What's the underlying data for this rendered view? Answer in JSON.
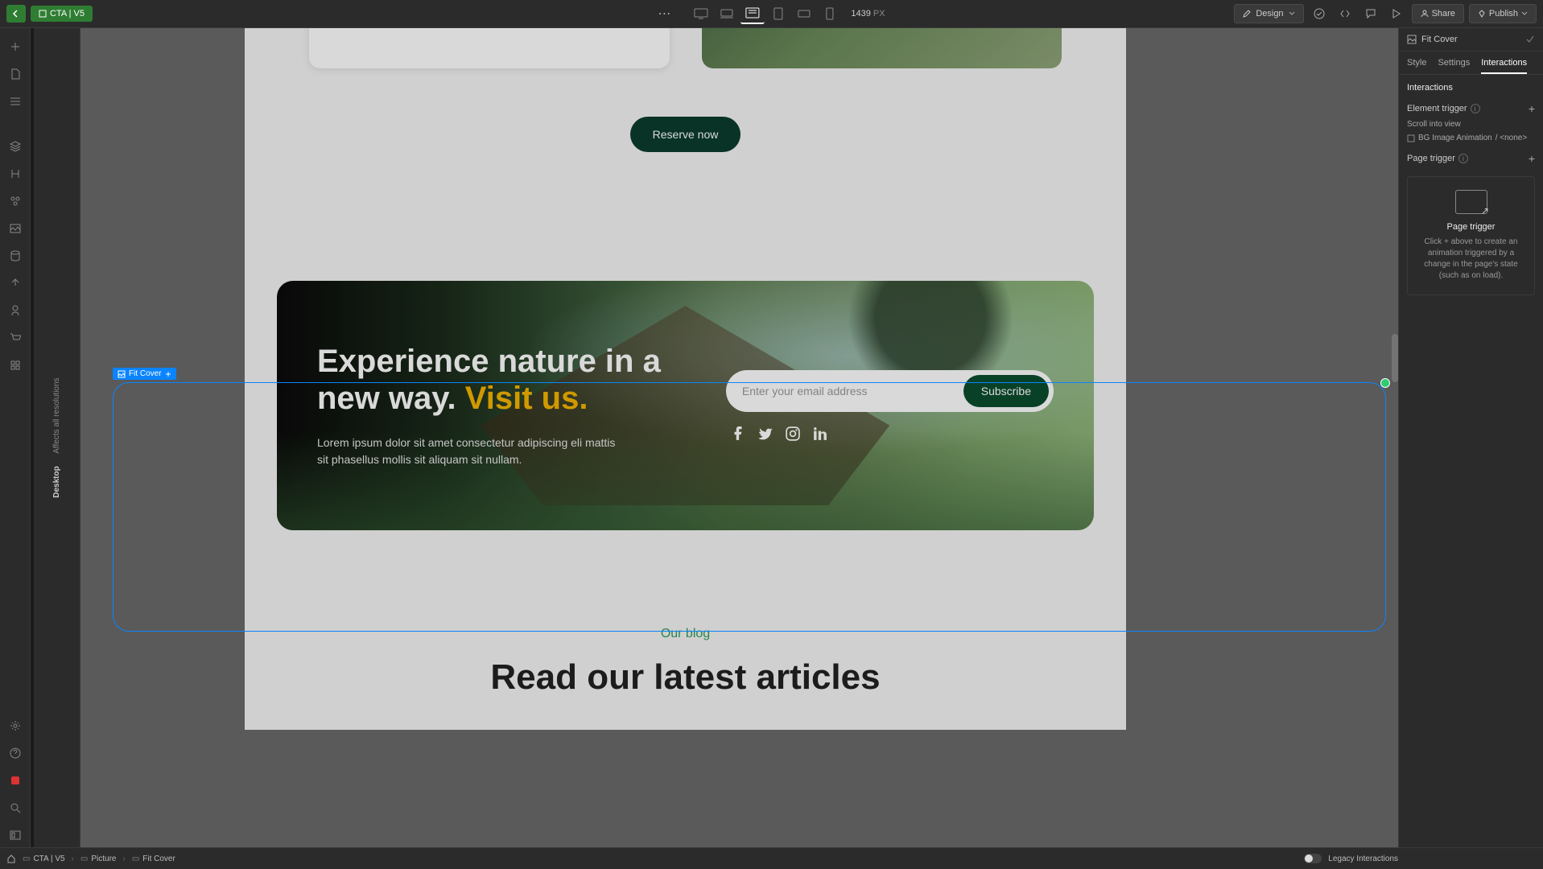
{
  "topbar": {
    "breadcrumb_label": "CTA | V5",
    "width_value": "1439",
    "width_unit": "PX",
    "mode_label": "Design",
    "share_label": "Share",
    "publish_label": "Publish"
  },
  "vert": {
    "primary": "Desktop",
    "secondary": "Affects all resolutions"
  },
  "canvas": {
    "selection_label": "Fit Cover",
    "reserve_label": "Reserve now",
    "cta_heading_main": "Experience nature in a new way. ",
    "cta_heading_accent": "Visit us.",
    "cta_body": "Lorem ipsum dolor sit amet consectetur adipiscing eli mattis sit phasellus mollis sit aliquam sit nullam.",
    "email_placeholder": "Enter your email address",
    "subscribe_label": "Subscribe",
    "blog_label": "Our blog",
    "blog_heading": "Read our latest articles"
  },
  "right": {
    "selected_name": "Fit Cover",
    "tabs": {
      "style": "Style",
      "settings": "Settings",
      "interactions": "Interactions"
    },
    "section_title": "Interactions",
    "element_trigger_label": "Element trigger",
    "scroll_trigger_label": "Scroll into view",
    "animation_name": "BG Image Animation",
    "animation_suffix": "/ <none>",
    "page_trigger_label": "Page trigger",
    "empty_title": "Page trigger",
    "empty_desc": "Click + above to create an animation triggered by a change in the page's state (such as on load)."
  },
  "bottom": {
    "crumb1": "CTA | V5",
    "crumb2": "Picture",
    "crumb3": "Fit Cover",
    "legacy_label": "Legacy Interactions"
  }
}
